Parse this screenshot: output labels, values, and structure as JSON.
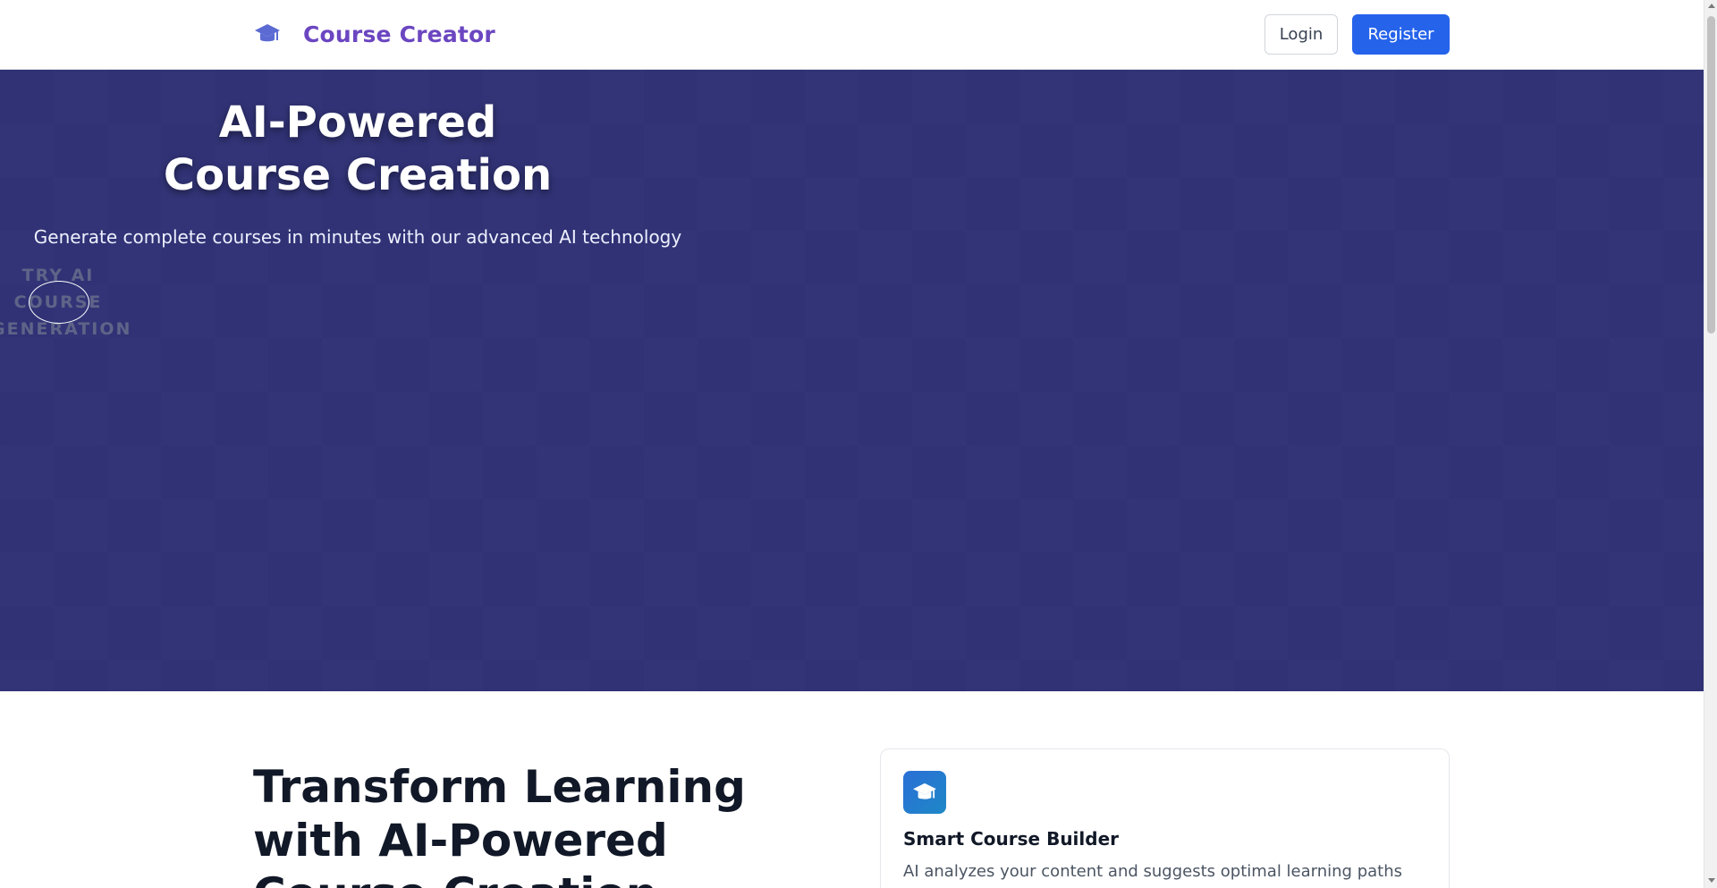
{
  "header": {
    "brand_name": "Course Creator",
    "brand_icon": "graduation-cap-icon",
    "login_label": "Login",
    "register_label": "Register"
  },
  "hero": {
    "title_line1": "AI-Powered",
    "title_line2": "Course Creation",
    "subtitle": "Generate complete courses in minutes with our advanced AI technology",
    "cta_line1": "TRY AI",
    "cta_line2": "COURSE",
    "cta_line3": "GENERATION"
  },
  "main": {
    "heading_line1": "Transform Learning",
    "heading_line2": "with AI-Powered",
    "heading_line3": "Course Creation"
  },
  "feature": {
    "icon": "graduation-cap-icon",
    "title": "Smart Course Builder",
    "description": "AI analyzes your content and suggests optimal learning paths"
  },
  "colors": {
    "brand": "#6b46c1",
    "primary_button": "#2563eb",
    "hero_background": "#303275"
  }
}
